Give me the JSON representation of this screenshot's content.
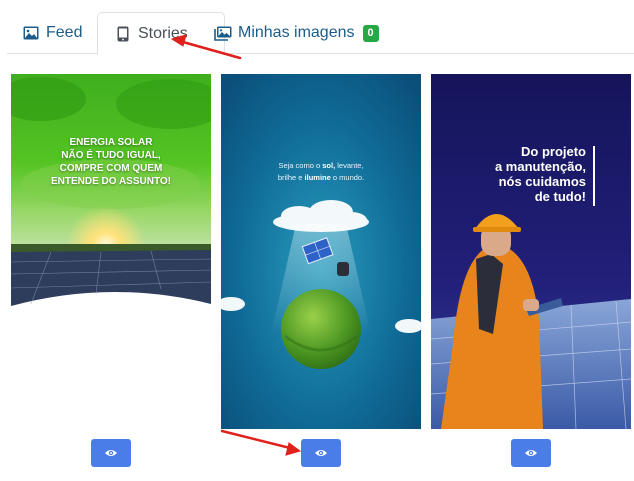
{
  "tabs": [
    {
      "label": "Feed",
      "icon": "image-icon"
    },
    {
      "label": "Stories",
      "icon": "mobile-icon",
      "active": true
    },
    {
      "label": "Minhas imagens",
      "icon": "images-icon",
      "badge": "0"
    }
  ],
  "cards": [
    {
      "text": "ENERGIA SOLAR\nNÃO É TUDO IGUAL,\nCOMPRE COM QUEM\nENTENDE DO ASSUNTO!"
    },
    {
      "text_line1": "Seja como o",
      "text_bold1": "sol,",
      "text_line1b": "levante,",
      "text_line2": "brilhe e",
      "text_bold2": "ilumine",
      "text_line2b": "o mundo."
    },
    {
      "text": "Do projeto\na manutenção,\nnós cuidamos\nde tudo!"
    }
  ],
  "colors": {
    "accent": "#4a7de8",
    "badge": "#28a745",
    "tab_link": "#1b5d8a",
    "annotation_arrow": "#e0201b"
  }
}
